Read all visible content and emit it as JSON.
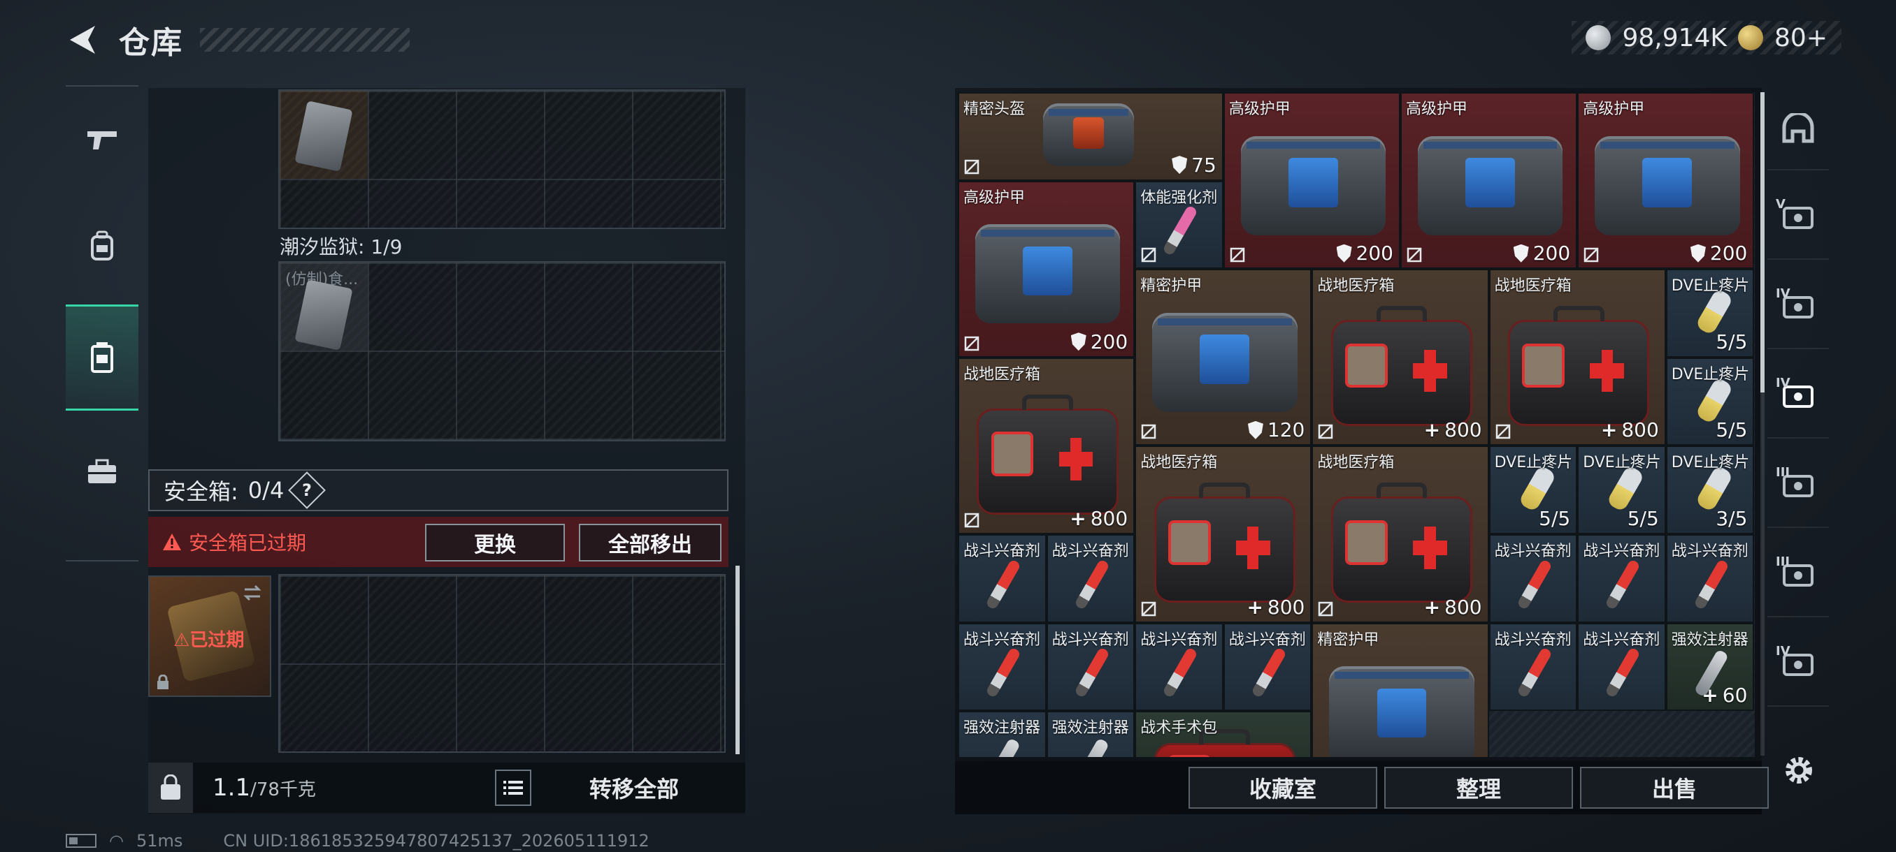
{
  "header": {
    "title": "仓库"
  },
  "currency": {
    "silver": "98,914K",
    "gold": "80+"
  },
  "left_categories": [
    {
      "name": "weapons",
      "icon": "gun-icon"
    },
    {
      "name": "equipment",
      "icon": "backpack-icon"
    },
    {
      "name": "container",
      "icon": "container-icon",
      "active": true
    },
    {
      "name": "tools",
      "icon": "toolbox-icon"
    }
  ],
  "storage": {
    "prison_label": "潮汐监狱: 1/9",
    "mini_item_text": "(仿制)食..."
  },
  "safe_box": {
    "label": "安全箱:",
    "count": "0/4",
    "help": "?",
    "alert": "安全箱已过期",
    "replace_button": "更换",
    "move_all_button": "全部移出",
    "expired_tag": "已过期"
  },
  "weight": {
    "current": "1.1",
    "capacity": "/78千克"
  },
  "transfer_all": "转移全部",
  "status": {
    "ping": "51ms",
    "uid": "CN UID:1861853259478074251​37_202605111912"
  },
  "inventory": {
    "items": [
      {
        "name": "精密头盔",
        "value": "75",
        "kind": "shield"
      },
      {
        "name": "高级护甲",
        "value": "200",
        "kind": "shield"
      },
      {
        "name": "高级护甲",
        "value": "200",
        "kind": "shield"
      },
      {
        "name": "高级护甲",
        "value": "200",
        "kind": "shield"
      },
      {
        "name": "高级护甲",
        "value": "200",
        "kind": "shield"
      },
      {
        "name": "体能强化剂",
        "value": "",
        "kind": "none"
      },
      {
        "name": "精密护甲",
        "value": "120",
        "kind": "shield"
      },
      {
        "name": "战地医疗箱",
        "value": "800",
        "kind": "heal"
      },
      {
        "name": "战地医疗箱",
        "value": "800",
        "kind": "heal"
      },
      {
        "name": "DVE止疼片",
        "value": "5/5",
        "kind": "count"
      },
      {
        "name": "DVE止疼片",
        "value": "5/5",
        "kind": "count"
      },
      {
        "name": "战地医疗箱",
        "value": "800",
        "kind": "heal"
      },
      {
        "name": "战地医疗箱",
        "value": "800",
        "kind": "heal"
      },
      {
        "name": "战地医疗箱",
        "value": "800",
        "kind": "heal"
      },
      {
        "name": "DVE止疼片",
        "value": "5/5",
        "kind": "count"
      },
      {
        "name": "DVE止疼片",
        "value": "5/5",
        "kind": "count"
      },
      {
        "name": "DVE止疼片",
        "value": "3/5",
        "kind": "count"
      },
      {
        "name": "战斗兴奋剂",
        "value": "",
        "kind": "none"
      },
      {
        "name": "战斗兴奋剂",
        "value": "",
        "kind": "none"
      },
      {
        "name": "战斗兴奋剂",
        "value": "",
        "kind": "none"
      },
      {
        "name": "战斗兴奋剂",
        "value": "",
        "kind": "none"
      },
      {
        "name": "战斗兴奋剂",
        "value": "",
        "kind": "none"
      },
      {
        "name": "战斗兴奋剂",
        "value": "",
        "kind": "none"
      },
      {
        "name": "战斗兴奋剂",
        "value": "",
        "kind": "none"
      },
      {
        "name": "战斗兴奋剂",
        "value": "",
        "kind": "none"
      },
      {
        "name": "战斗兴奋剂",
        "value": "",
        "kind": "none"
      },
      {
        "name": "精密护甲",
        "value": "",
        "kind": "none"
      },
      {
        "name": "战斗兴奋剂",
        "value": "",
        "kind": "none"
      },
      {
        "name": "战斗兴奋剂",
        "value": "",
        "kind": "none"
      },
      {
        "name": "强效注射器",
        "value": "60",
        "kind": "heal"
      },
      {
        "name": "强效注射器",
        "value": "",
        "kind": "none"
      },
      {
        "name": "强效注射器",
        "value": "",
        "kind": "none"
      },
      {
        "name": "战术手术包",
        "value": "",
        "kind": "none"
      }
    ]
  },
  "footer_buttons": {
    "collection": "收藏室",
    "sort": "整理",
    "sell": "出售"
  },
  "right_categories": [
    {
      "icon": "helmet-icon",
      "tier": ""
    },
    {
      "icon": "armor-rig-icon",
      "tier": "V"
    },
    {
      "icon": "backpack-icon",
      "tier": "IV"
    },
    {
      "icon": "medkit-icon",
      "tier": "IV"
    },
    {
      "icon": "ammo-icon",
      "tier": "III"
    },
    {
      "icon": "tools-icon",
      "tier": "III"
    },
    {
      "icon": "keycard-icon",
      "tier": "IV"
    }
  ],
  "colors": {
    "accent": "#36d6a8",
    "alert": "#ff5a52",
    "armor_bg": "#5a2327",
    "item_bg": "#4a3b2f",
    "consumable_bg": "#283746"
  }
}
